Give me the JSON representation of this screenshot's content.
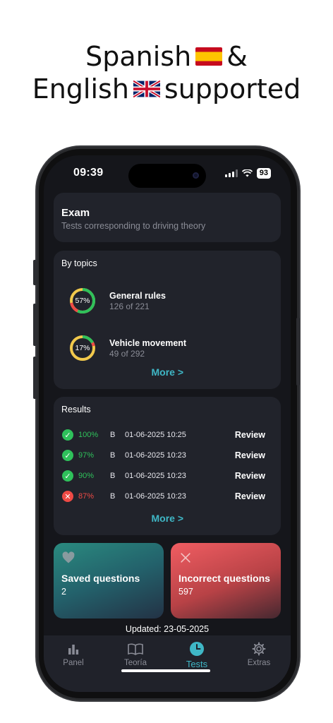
{
  "promo": {
    "line1_text": "Spanish",
    "line1_suffix": "&",
    "line2_text": "English",
    "line2_suffix": "supported"
  },
  "status_bar": {
    "time": "09:39",
    "battery": "93"
  },
  "exam_card": {
    "title": "Exam",
    "subtitle": "Tests corresponding to driving theory"
  },
  "topics_card": {
    "title": "By topics",
    "items": [
      {
        "name": "General rules",
        "count": "126 of 221",
        "percent_label": "57%",
        "correct_fraction": 0.57,
        "wrong_fraction": 0.15
      },
      {
        "name": "Vehicle movement",
        "count": "49 of 292",
        "percent_label": "17%",
        "correct_fraction": 0.17,
        "wrong_fraction": 0.05
      }
    ],
    "more_label": "More >"
  },
  "results_card": {
    "title": "Results",
    "rows": [
      {
        "status": "pass",
        "percent": "100%",
        "category": "B",
        "date": "01-06-2025 10:25",
        "action": "Review"
      },
      {
        "status": "pass",
        "percent": "97%",
        "category": "B",
        "date": "01-06-2025 10:23",
        "action": "Review"
      },
      {
        "status": "pass",
        "percent": "90%",
        "category": "B",
        "date": "01-06-2025 10:23",
        "action": "Review"
      },
      {
        "status": "fail",
        "percent": "87%",
        "category": "B",
        "date": "01-06-2025 10:23",
        "action": "Review"
      }
    ],
    "more_label": "More >"
  },
  "saved_tile": {
    "label": "Saved questions",
    "value": "2",
    "icon": "heart-icon"
  },
  "incorrect_tile": {
    "label": "Incorrect questions",
    "value": "597",
    "icon": "close-icon"
  },
  "updated_text": "Updated: 23-05-2025",
  "tabbar": {
    "tabs": [
      {
        "label": "Panel",
        "icon": "bar-chart-icon"
      },
      {
        "label": "Teoría",
        "icon": "book-icon"
      },
      {
        "label": "Tests",
        "icon": "clock-icon",
        "active": true
      },
      {
        "label": "Extras",
        "icon": "gear-icon"
      }
    ]
  },
  "colors": {
    "accent": "#3fb7c6",
    "pass": "#2fc15b",
    "fail": "#ee4a45",
    "ring_track": "#f2c94c"
  }
}
